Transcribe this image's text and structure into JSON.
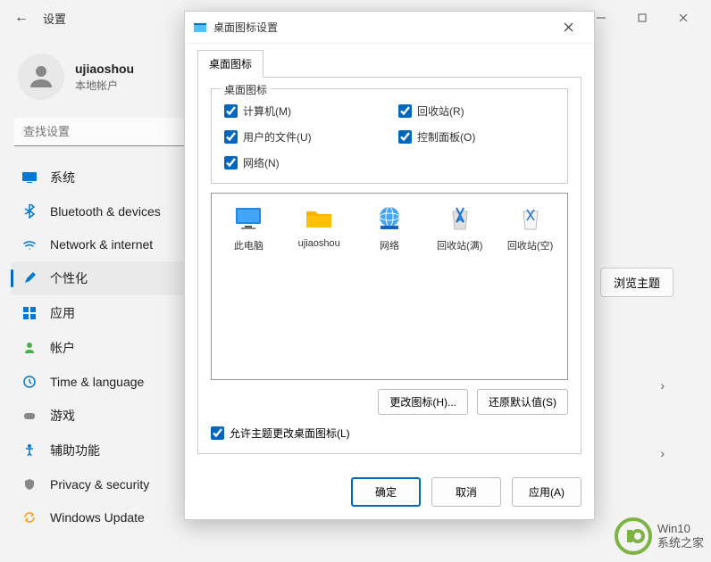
{
  "titlebar": {
    "title": "设置"
  },
  "user": {
    "name": "ujiaoshou",
    "account_type": "本地帐户"
  },
  "search": {
    "placeholder": "查找设置"
  },
  "sidebar": {
    "items": [
      {
        "label": "系统"
      },
      {
        "label": "Bluetooth & devices"
      },
      {
        "label": "Network & internet"
      },
      {
        "label": "个性化"
      },
      {
        "label": "应用"
      },
      {
        "label": "帐户"
      },
      {
        "label": "Time & language"
      },
      {
        "label": "游戏"
      },
      {
        "label": "辅助功能"
      },
      {
        "label": "Privacy & security"
      },
      {
        "label": "Windows Update"
      }
    ]
  },
  "content": {
    "browse_theme": "浏览主题"
  },
  "dialog": {
    "title": "桌面图标设置",
    "tab": "桌面图标",
    "fieldset_legend": "桌面图标",
    "checks": {
      "computer": "计算机(M)",
      "recycle": "回收站(R)",
      "userfiles": "用户的文件(U)",
      "control": "控制面板(O)",
      "network": "网络(N)"
    },
    "icons": [
      {
        "label": "此电脑"
      },
      {
        "label": "ujiaoshou"
      },
      {
        "label": "网络"
      },
      {
        "label": "回收站(满)"
      },
      {
        "label": "回收站(空)"
      }
    ],
    "change_icon": "更改图标(H)...",
    "restore_default": "还原默认值(S)",
    "allow_theme": "允许主题更改桌面图标(L)",
    "ok": "确定",
    "cancel": "取消",
    "apply": "应用(A)"
  },
  "watermark": {
    "line1": "Win10",
    "line2": "系统之家"
  }
}
